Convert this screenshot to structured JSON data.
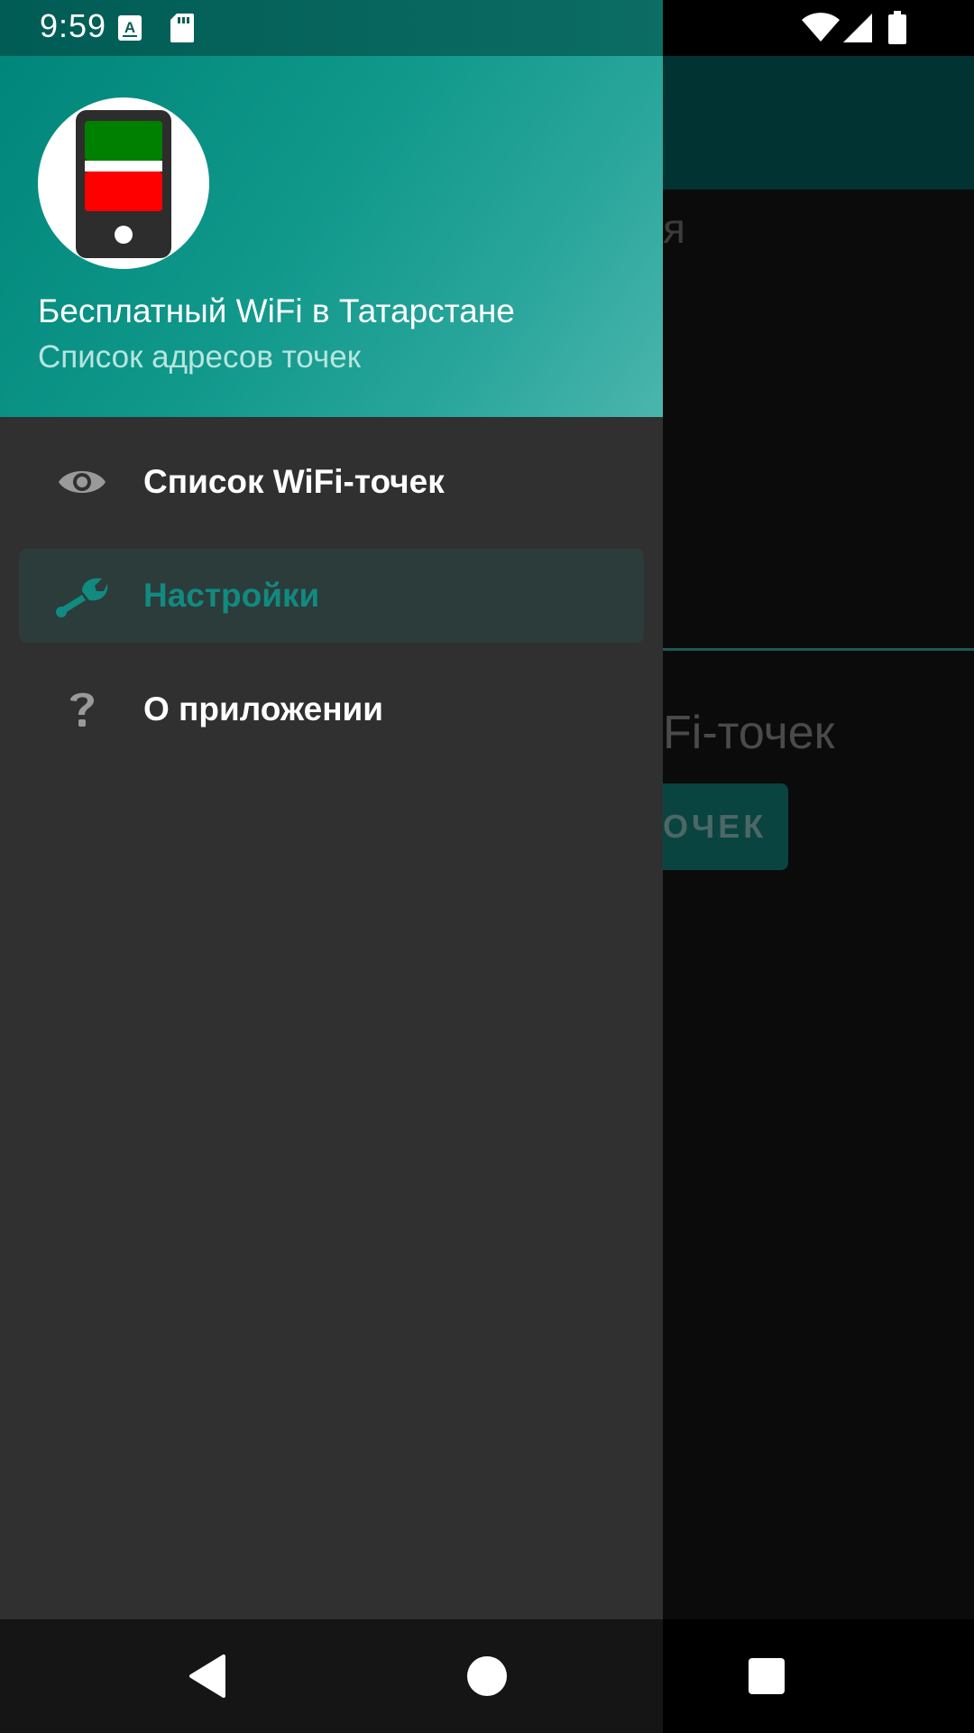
{
  "status_bar": {
    "time": "9:59",
    "icons": [
      "text-a-icon",
      "sd-card-icon",
      "wifi-icon",
      "signal-icon",
      "battery-icon"
    ]
  },
  "background_app": {
    "section_title_fragment": "я",
    "card_title_fragment": "Fi-точек",
    "button_fragment": "ОЧЕК"
  },
  "drawer": {
    "header": {
      "title": "Бесплатный WiFi в Татарстане",
      "subtitle": "Список адресов точек"
    },
    "items": [
      {
        "label": "Список WiFi-точек",
        "icon": "eye-icon",
        "active": false
      },
      {
        "label": "Настройки",
        "icon": "wrench-icon",
        "active": true
      },
      {
        "label": "О приложении",
        "icon": "help-icon",
        "active": false
      }
    ]
  },
  "colors": {
    "accent": "#118a80",
    "header_gradient_start": "#00867a",
    "header_gradient_end": "#4bb5ac",
    "drawer_bg": "#303030",
    "active_item_bg": "#2b3c3b",
    "flag_green": "#008000",
    "flag_white": "#ffffff",
    "flag_red": "#ff0000"
  },
  "nav_bar": {
    "buttons": [
      "back-icon",
      "home-icon",
      "recents-icon"
    ]
  }
}
